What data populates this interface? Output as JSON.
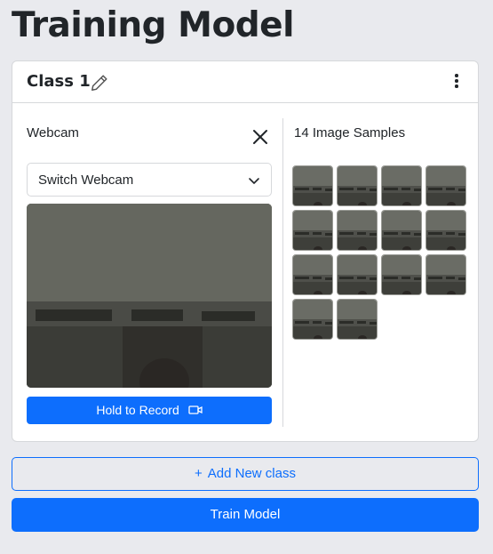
{
  "page": {
    "title": "Training Model"
  },
  "class_card": {
    "name": "Class 1",
    "edit_icon": "pencil-icon",
    "menu_icon": "kebab-menu-icon",
    "webcam": {
      "label": "Webcam",
      "close_icon": "close-icon",
      "select_value": "Switch Webcam",
      "select_icon": "chevron-down-icon",
      "record_label": "Hold to Record",
      "record_icon": "video-camera-icon"
    },
    "samples": {
      "label": "14 Image Samples",
      "count": 14
    }
  },
  "actions": {
    "add_plus": "+",
    "add_label": "Add New class",
    "train_label": "Train Model"
  },
  "colors": {
    "primary": "#0d6efd",
    "background": "#e9eaee",
    "card": "#ffffff"
  }
}
